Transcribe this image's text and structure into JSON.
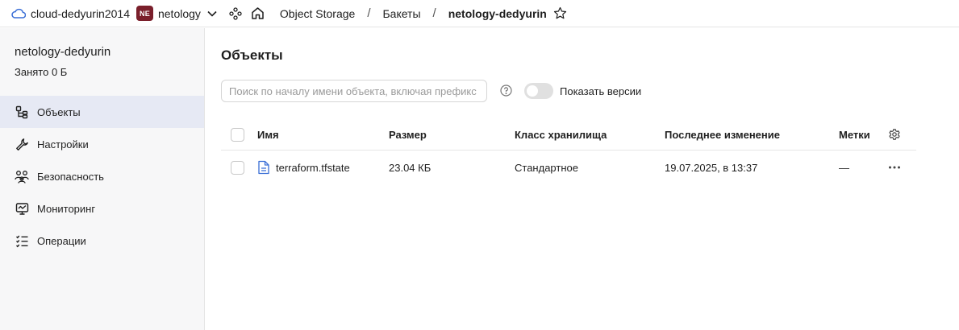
{
  "topbar": {
    "cloud_name": "cloud-dedyurin2014",
    "org_badge": "NE",
    "org_name": "netology",
    "service": "Object Storage",
    "section": "Бакеты",
    "current": "netology-dedyurin",
    "icons": [
      "cloud-icon",
      "chevron-down-icon",
      "services-icon",
      "home-icon",
      "star-icon"
    ],
    "badge_color": "#7a1f2b"
  },
  "sidebar": {
    "bucket_name": "netology-dedyurin",
    "usage": "Занято 0 Б",
    "items": [
      {
        "label": "Объекты",
        "icon": "objects-icon",
        "active": true
      },
      {
        "label": "Настройки",
        "icon": "wrench-icon",
        "active": false
      },
      {
        "label": "Безопасность",
        "icon": "users-icon",
        "active": false
      },
      {
        "label": "Мониторинг",
        "icon": "monitor-icon",
        "active": false
      },
      {
        "label": "Операции",
        "icon": "list-icon",
        "active": false
      }
    ],
    "active_bg": "#e6e9f4"
  },
  "main": {
    "title": "Объекты",
    "search_placeholder": "Поиск по началу имени объекта, включая префикс",
    "search_value": "",
    "show_versions_label": "Показать версии",
    "show_versions_on": false,
    "table": {
      "columns": [
        "Имя",
        "Размер",
        "Класс хранилища",
        "Последнее изменение",
        "Метки"
      ],
      "rows": [
        {
          "name": "terraform.tfstate",
          "size": "23.04 КБ",
          "storage_class": "Стандартное",
          "modified": "19.07.2025, в 13:37",
          "tags": "—"
        }
      ]
    }
  }
}
